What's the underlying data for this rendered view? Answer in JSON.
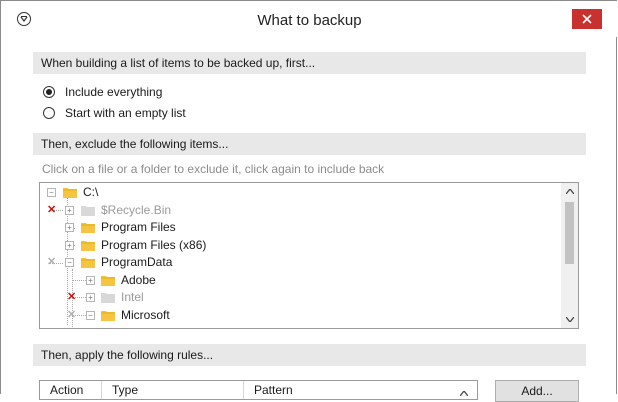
{
  "window": {
    "title": "What to backup"
  },
  "section1": {
    "header": "When building a list of items to be backed up, first...",
    "options": [
      {
        "label": "Include everything",
        "selected": true
      },
      {
        "label": "Start with an empty list",
        "selected": false
      }
    ]
  },
  "section2": {
    "header": "Then, exclude the following items...",
    "hint": "Click on a file or a folder to exclude it, click again to include back",
    "tree": [
      {
        "label": "C:\\",
        "state": "included",
        "expander": "minus"
      },
      {
        "label": "$Recycle.Bin",
        "state": "excluded",
        "expander": "plus"
      },
      {
        "label": "Program Files",
        "state": "included",
        "expander": "plus"
      },
      {
        "label": "Program Files (x86)",
        "state": "included",
        "expander": "plus"
      },
      {
        "label": "ProgramData",
        "state": "partial",
        "expander": "minus"
      },
      {
        "label": "Adobe",
        "state": "included",
        "expander": "plus"
      },
      {
        "label": "Intel",
        "state": "excluded",
        "expander": "plus"
      },
      {
        "label": "Microsoft",
        "state": "partial",
        "expander": "minus"
      }
    ]
  },
  "section3": {
    "header": "Then, apply the following rules...",
    "columns": [
      "Action",
      "Type",
      "Pattern"
    ],
    "add_button": "Add..."
  },
  "colors": {
    "close_button": "#c9312e",
    "exclude_mark": "#cc1111",
    "folder": "#f5c542",
    "folder_dim": "#d8d8d8"
  }
}
